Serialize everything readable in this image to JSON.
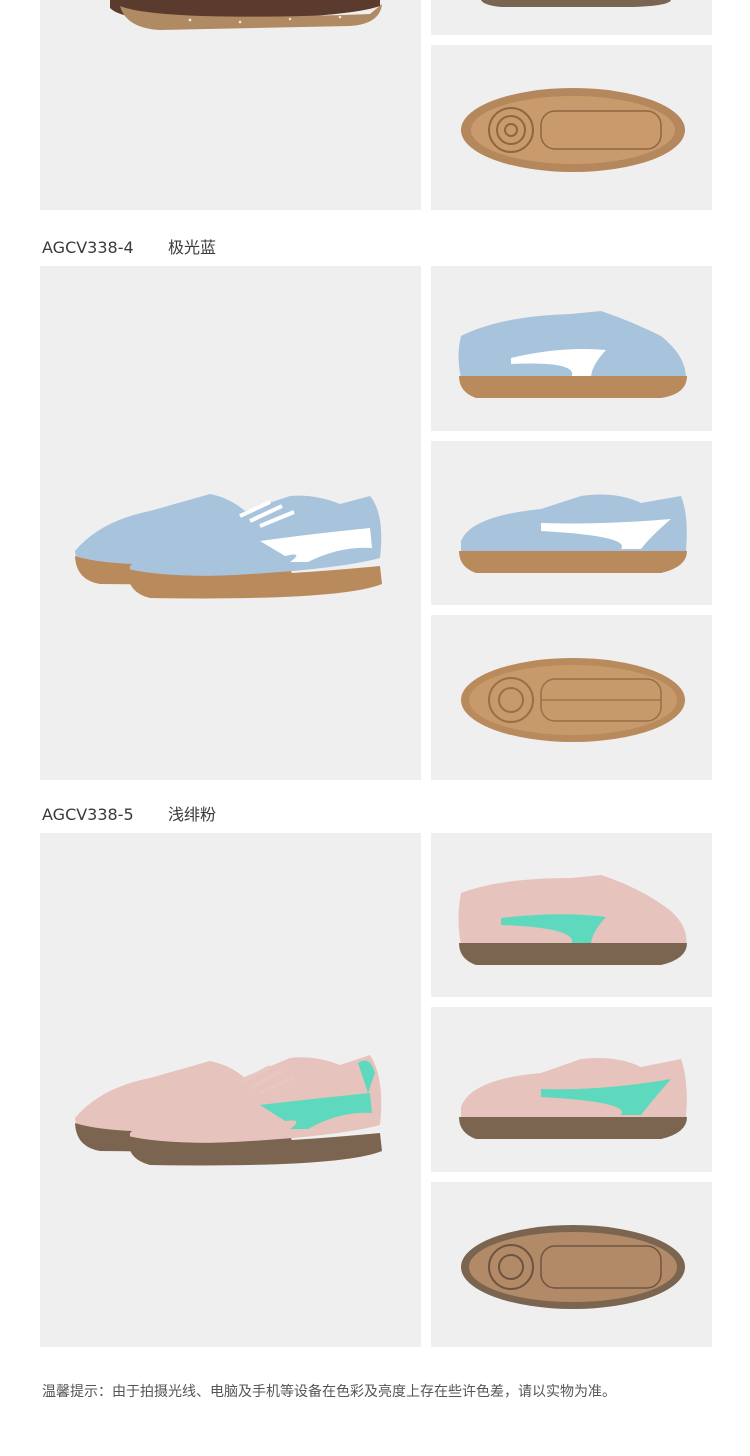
{
  "variants": [
    {
      "code": "",
      "color_name": "",
      "upper": "#6b4a3a",
      "stripe": "#6b4a3a",
      "sole": "#a07650"
    },
    {
      "code": "AGCV338-4",
      "color_name": "极光蓝",
      "upper": "#a8c3dc",
      "stripe": "#ffffff",
      "sole": "#b98a5c"
    },
    {
      "code": "AGCV338-5",
      "color_name": "浅绯粉",
      "upper": "#e6c3bd",
      "stripe": "#5fd9be",
      "sole": "#7b6550"
    }
  ],
  "footer": {
    "note": "温馨提示：由于拍摄光线、电脑及手机等设备在色彩及亮度上存在些许色差，请以实物为准。"
  }
}
